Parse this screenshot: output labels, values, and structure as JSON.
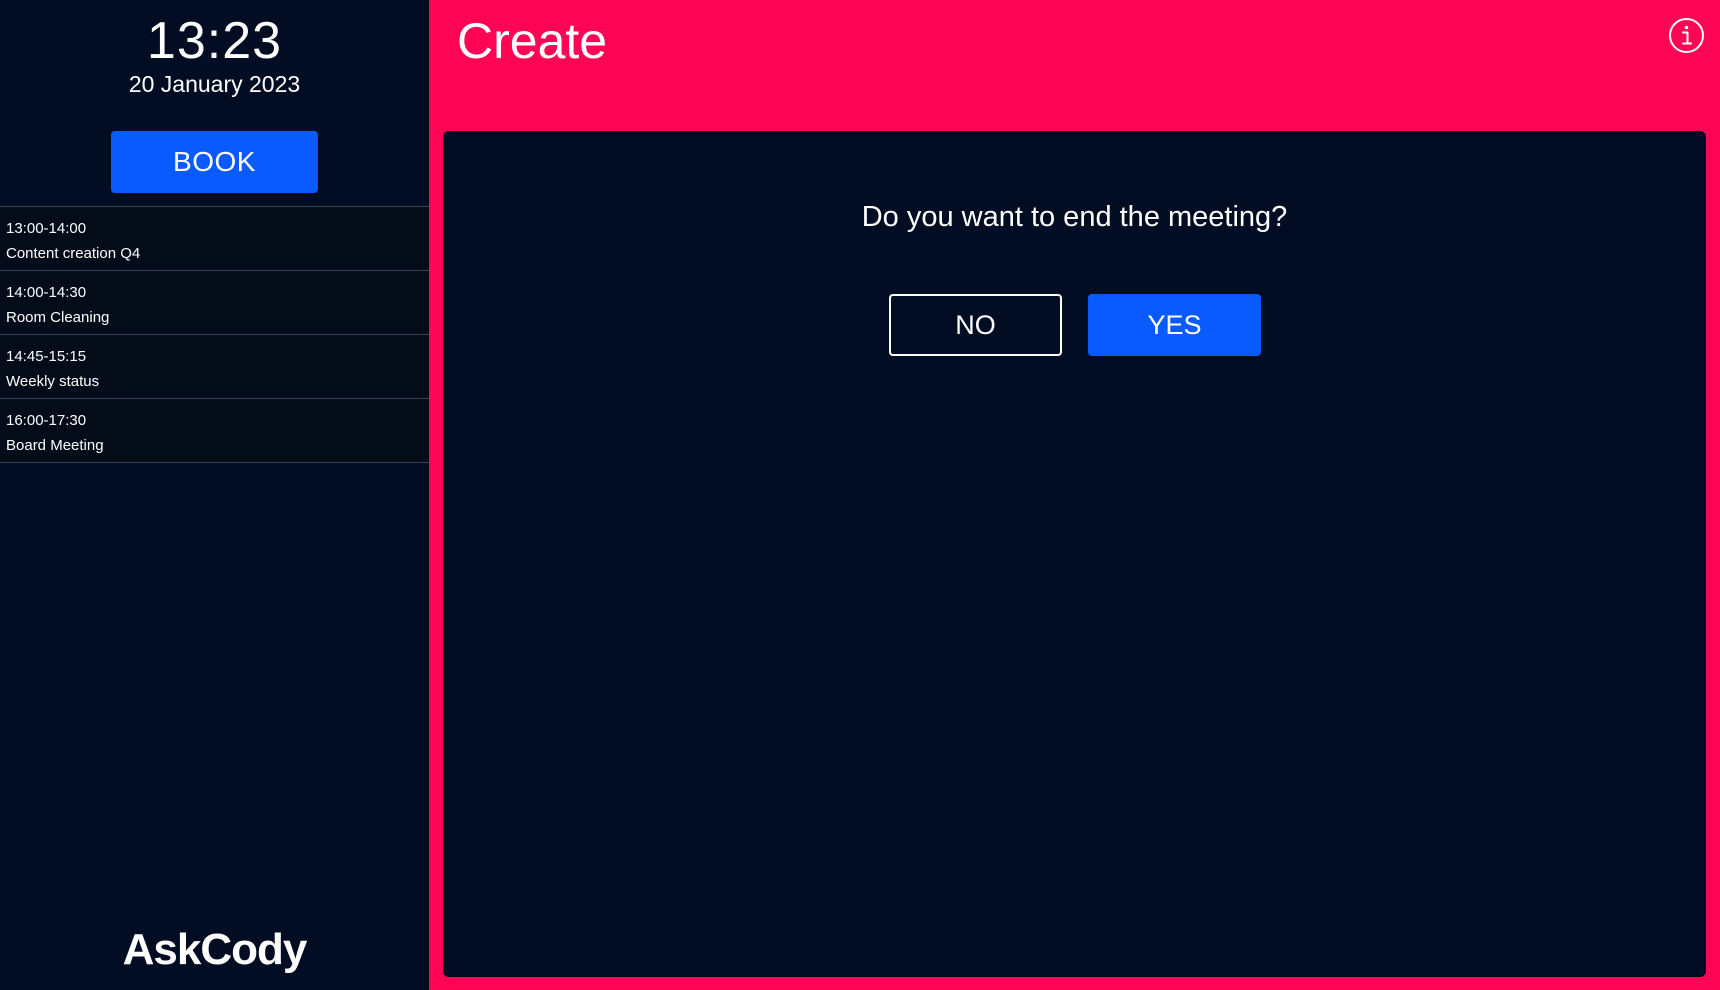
{
  "sidebar": {
    "time": "13:23",
    "date": "20 January 2023",
    "book_label": "BOOK",
    "schedule": [
      {
        "time": "13:00-14:00",
        "title": "Content creation Q4"
      },
      {
        "time": "14:00-14:30",
        "title": "Room Cleaning"
      },
      {
        "time": "14:45-15:15",
        "title": "Weekly status"
      },
      {
        "time": "16:00-17:30",
        "title": "Board Meeting"
      }
    ],
    "brand": "AskCody"
  },
  "header": {
    "title": "Create",
    "info_icon": "info-icon"
  },
  "dialog": {
    "question": "Do you want to end the meeting?",
    "no_label": "NO",
    "yes_label": "YES"
  },
  "colors": {
    "sidebar_bg": "#020d24",
    "accent": "#ff0555",
    "primary_button": "#0a5bff"
  }
}
